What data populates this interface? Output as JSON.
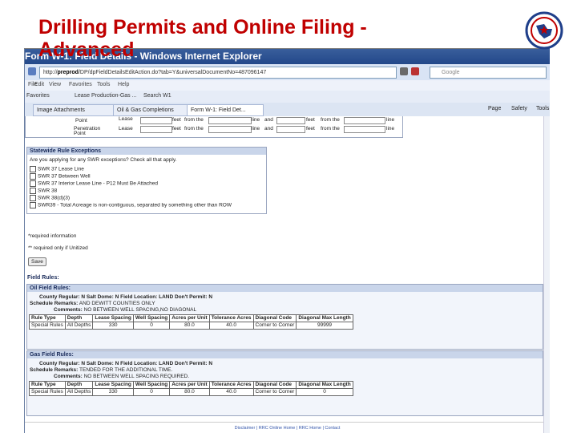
{
  "slide": {
    "title_line1": "Drilling Permits and Online Filing -",
    "title_line2": "Advanced"
  },
  "browser": {
    "window_title": "Form W-1: Field Details - Windows Internet Explorer",
    "url_prefix": "http://",
    "url_host": "preprod",
    "url_rest": "/DP/dpFieldDetailsEditAction.do?tab=Y&universalDocumentNo=487096147",
    "search_placeholder": "Google",
    "menu": [
      "File",
      "Edit",
      "View",
      "Favorites",
      "Tools",
      "Help"
    ],
    "favorites": [
      "Favorites",
      "Lease Production-Gas ...",
      "Search W1"
    ],
    "tabs": [
      "Image Attachments",
      "Oil & Gas Completions",
      "Form W-1: Field Det..."
    ],
    "toolbar_right": [
      "Page",
      "Safety",
      "Tools"
    ]
  },
  "location_rows": [
    {
      "label": "Point",
      "type": ""
    },
    {
      "label": "Penetration Point",
      "type": "Lease"
    }
  ],
  "location_words": {
    "feet": "feet",
    "from_the": "from the",
    "line": "line",
    "and": "and",
    "lease": "Lease"
  },
  "swr": {
    "header": "Statewide Rule Exceptions",
    "question": "Are you applying for any SWR exceptions? Check all that apply.",
    "options": [
      "SWR 37 Lease Line",
      "SWR 37 Between Well",
      "SWR 37 Interior Lease Line - P12 Must Be Attached",
      "SWR 38",
      "SWR 38(d)(3)",
      "SWR39 - Total Acreage is non-contiguous, separated by something other than ROW"
    ]
  },
  "notes": {
    "required": "*required information",
    "unitized": "** required only if Unitized",
    "save_label": "Save"
  },
  "field_rules": {
    "heading": "Field Rules:",
    "oil": {
      "header": "Oil Field Rules:",
      "line1": "County Regular: N   Salt Dome: N   Field Location: LAND   Don't Permit: N",
      "remarks_label": "Schedule Remarks:",
      "remarks": "AND DEWITT COUNTIES ONLY",
      "comments_label": "Comments:",
      "comments": "NO BETWEEN WELL SPACING,NO DIAGONAL",
      "row": [
        "Special Rules",
        "All Depths",
        "330",
        "0",
        "80.0",
        "40.0",
        "Corner to Corner",
        "99999"
      ]
    },
    "gas": {
      "header": "Gas Field Rules:",
      "line1": "County Regular: N   Salt Dome: N   Field Location: LAND   Don't Permit: N",
      "remarks_label": "Schedule Remarks:",
      "remarks": "TENDED FOR THE ADDITIONAL TIME.",
      "comments_label": "Comments:",
      "comments": "NO BETWEEN WELL SPACING REQUIRED.",
      "row": [
        "Special Rules",
        "All Depths",
        "330",
        "0",
        "80.0",
        "40.0",
        "Corner to Corner",
        "0"
      ]
    },
    "columns": [
      "Rule Type",
      "Depth",
      "Lease Spacing",
      "Well Spacing",
      "Acres per Unit",
      "Tolerance Acres",
      "Diagonal Code",
      "Diagonal Max Length"
    ]
  },
  "footer": "Disclaimer | RRC Online Home | RRC Home | Contact",
  "colors": {
    "title": "#c00000",
    "ie_titlebar": "#23488a",
    "section_header": "#c9d5ea"
  }
}
